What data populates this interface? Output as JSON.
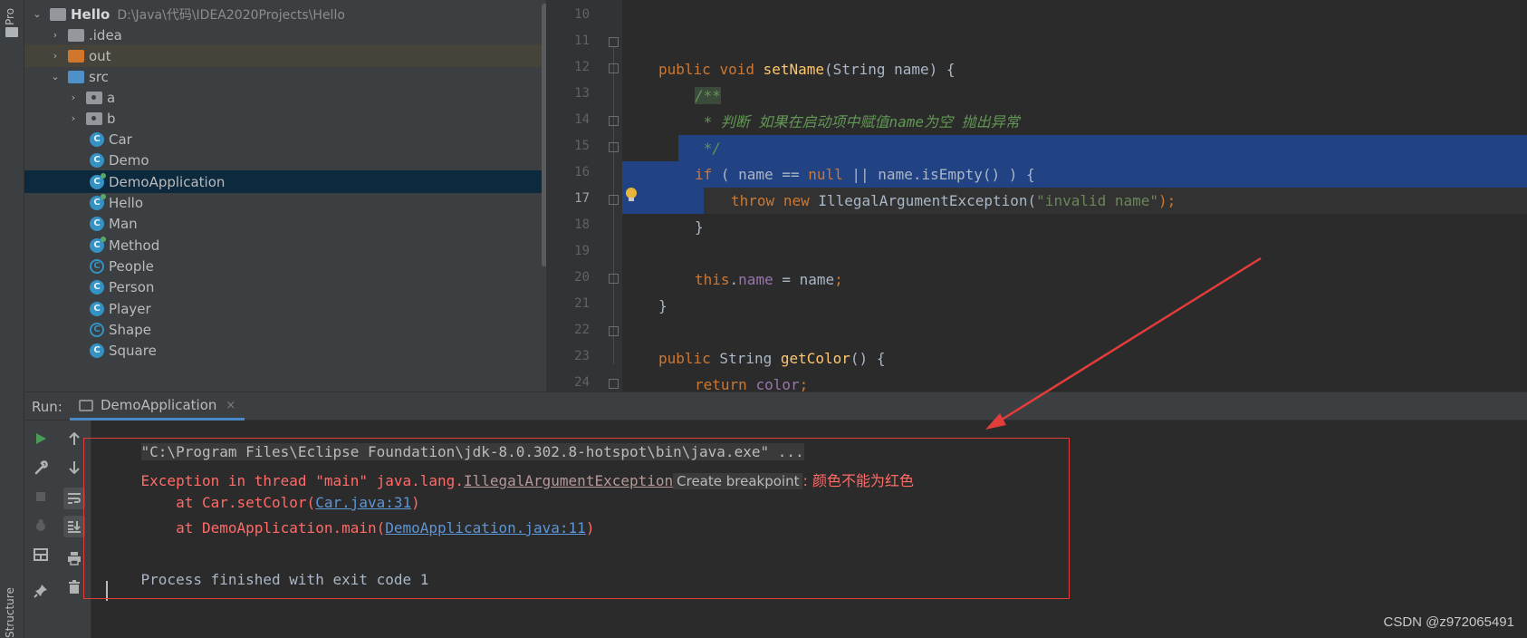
{
  "sidebar": {
    "project_tab": "Pro",
    "structure_tab": "Structure"
  },
  "project_tree": {
    "root": {
      "name": "Hello",
      "path": "D:\\Java\\代码\\IDEA2020Projects\\Hello"
    },
    "items": [
      {
        "label": "idea",
        "label_full": ".idea"
      },
      {
        "label_full": "out"
      },
      {
        "label_full": "src"
      },
      {
        "label_full": "a"
      },
      {
        "label_full": "b"
      },
      {
        "label_full": "Car"
      },
      {
        "label_full": "Demo"
      },
      {
        "label_full": "DemoApplication"
      },
      {
        "label_full": "Hello"
      },
      {
        "label_full": "Man"
      },
      {
        "label_full": "Method"
      },
      {
        "label_full": "People"
      },
      {
        "label_full": "Person"
      },
      {
        "label_full": "Player"
      },
      {
        "label_full": "Shape"
      },
      {
        "label_full": "Square"
      }
    ],
    "class_letter": "C"
  },
  "editor": {
    "line_numbers": [
      "10",
      "11",
      "12",
      "13",
      "14",
      "15",
      "16",
      "17",
      "18",
      "19",
      "20",
      "21",
      "22",
      "23",
      "24"
    ],
    "current_line": "17",
    "code": {
      "l11_public": "public",
      "l11_void": "void",
      "l11_fn": "setName",
      "l11_rest": "(String name) {",
      "l12": "/**",
      "l13": " * 判断 如果在启动项中赋值name为空 抛出异常",
      "l14": " */",
      "l15_if": "if",
      "l15_a": " ( name == ",
      "l15_null": "null",
      "l15_b": " || name.isEmpty() ) {",
      "l16_throw": "throw",
      "l16_new": "new",
      "l16_cls": " IllegalArgumentException(",
      "l16_str": "\"invalid name\"",
      "l16_end": ");",
      "l17": "}",
      "l19_this": "this",
      "l19_dot": ".",
      "l19_field": "name",
      "l19_rest": " = name",
      "l19_semi": ";",
      "l20": "}",
      "l22_public": "public",
      "l22_type": " String ",
      "l22_fn": "getColor",
      "l22_rest": "() {",
      "l23_return": "return",
      "l23_field": "color",
      "l23_semi": ";",
      "l24": "}"
    }
  },
  "run_panel": {
    "label": "Run:",
    "tab_label": "DemoApplication",
    "tab_close": "×",
    "console": {
      "command": "\"C:\\Program Files\\Eclipse Foundation\\jdk-8.0.302.8-hotspot\\bin\\java.exe\" ...",
      "exception_prefix": "Exception in thread \"main\" java.lang.",
      "exception_class": "IllegalArgumentException",
      "create_breakpoint": "Create breakpoint",
      "exception_message": ": 颜色不能为红色",
      "trace1_prefix": "    at Car.setColor(",
      "trace1_link": "Car.java:31",
      "trace1_suffix": ")",
      "trace2_prefix": "    at DemoApplication.main(",
      "trace2_link": "DemoApplication.java:11",
      "trace2_suffix": ")",
      "exit_message": "Process finished with exit code 1"
    }
  },
  "watermark": "CSDN @z972065491",
  "colors": {
    "keyword": "#cc7832",
    "function": "#ffc66d",
    "string": "#6a8759",
    "doc_comment": "#629755",
    "error": "#ff6b68",
    "link": "#5d95d5",
    "selection": "#214283",
    "annotation_red": "#e23d3a"
  }
}
